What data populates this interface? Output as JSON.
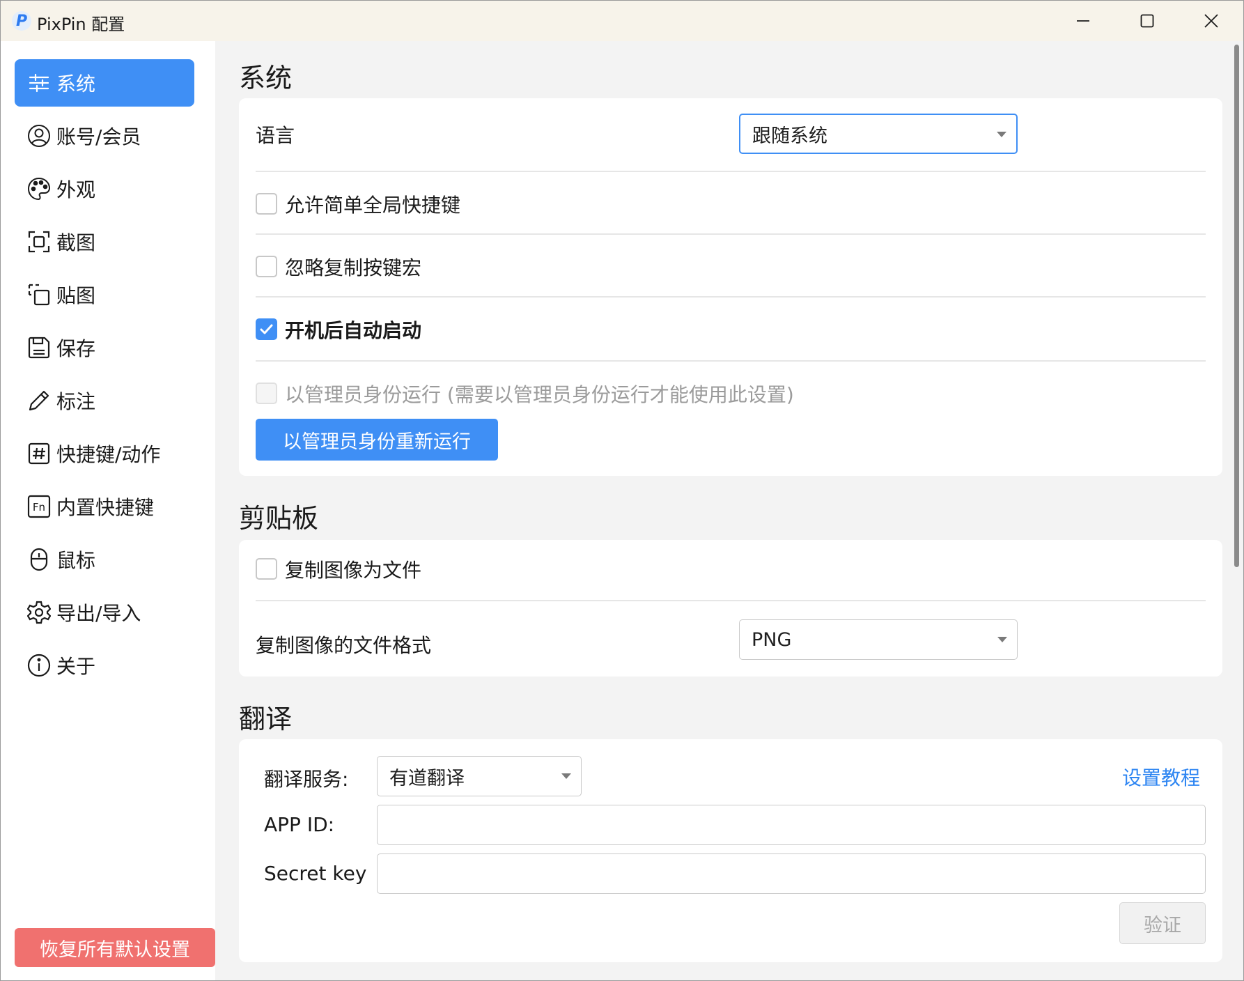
{
  "window": {
    "logo_letter": "P",
    "title": "PixPin 配置"
  },
  "sidebar": {
    "items": [
      {
        "label": "系统",
        "icon": "sliders-icon"
      },
      {
        "label": "账号/会员",
        "icon": "user-circle-icon"
      },
      {
        "label": "外观",
        "icon": "palette-icon"
      },
      {
        "label": "截图",
        "icon": "screenshot-frame-icon"
      },
      {
        "label": "贴图",
        "icon": "pin-window-icon"
      },
      {
        "label": "保存",
        "icon": "floppy-disk-icon"
      },
      {
        "label": "标注",
        "icon": "pencil-icon"
      },
      {
        "label": "快捷键/动作",
        "icon": "hash-box-icon"
      },
      {
        "label": "内置快捷键",
        "icon": "fn-key-icon"
      },
      {
        "label": "鼠标",
        "icon": "mouse-icon"
      },
      {
        "label": "导出/导入",
        "icon": "gear-icon"
      },
      {
        "label": "关于",
        "icon": "info-icon"
      }
    ],
    "reset_label": "恢复所有默认设置"
  },
  "system": {
    "title": "系统",
    "language_label": "语言",
    "language_value": "跟随系统",
    "simple_hotkey_label": "允许简单全局快捷键",
    "ignore_macro_label": "忽略复制按键宏",
    "autostart_label": "开机后自动启动",
    "run_admin_label": "以管理员身份运行 (需要以管理员身份运行才能使用此设置)",
    "rerun_admin_button": "以管理员身份重新运行"
  },
  "clipboard": {
    "title": "剪贴板",
    "copy_as_file_label": "复制图像为文件",
    "format_label": "复制图像的文件格式",
    "format_value": "PNG"
  },
  "translate": {
    "title": "翻译",
    "service_label": "翻译服务:",
    "service_value": "有道翻译",
    "tutorial_link": "设置教程",
    "app_id_label": "APP ID:",
    "app_id_value": "",
    "secret_label": "Secret key",
    "secret_value": "",
    "verify_button": "验证"
  },
  "colors": {
    "accent": "#3f8ff5",
    "danger": "#f0716f",
    "link": "#2f86f2"
  }
}
